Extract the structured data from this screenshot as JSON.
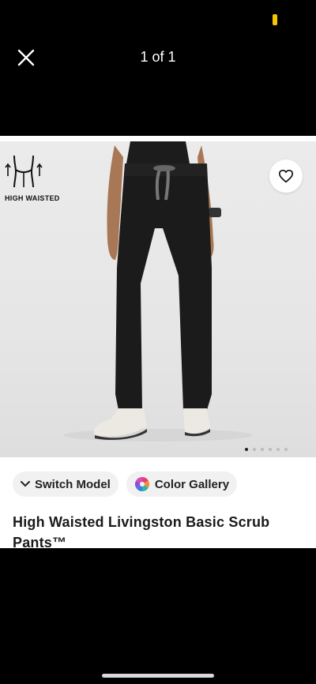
{
  "viewer": {
    "counter": "1 of 1"
  },
  "product": {
    "badge_label": "HIGH WAISTED",
    "title": "High Waisted Livingston Basic Scrub Pants™",
    "image_count": 6,
    "active_image_index": 0
  },
  "actions": {
    "switch_model_label": "Switch Model",
    "color_gallery_label": "Color Gallery"
  },
  "icons": {
    "close": "close-icon",
    "favorite": "heart-icon",
    "switch_model": "chevron-down-icon",
    "color_gallery": "color-wheel-icon",
    "badge": "high-waist-icon"
  },
  "colors": {
    "status_indicator": "#f7c600",
    "background": "#000000"
  }
}
